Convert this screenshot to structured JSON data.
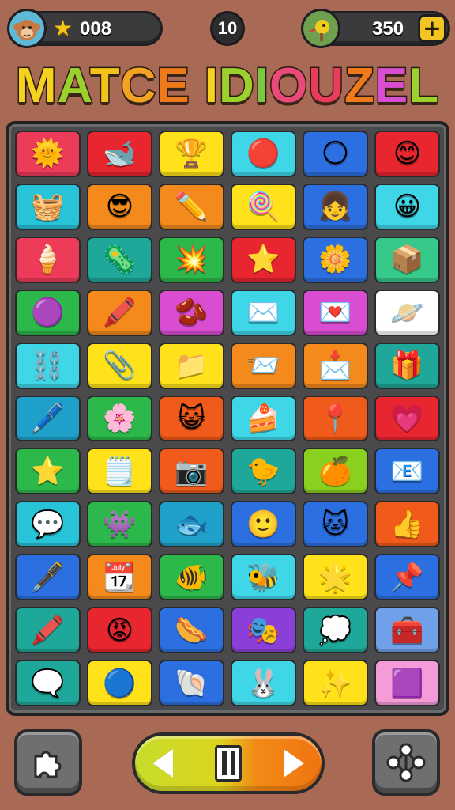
{
  "hud": {
    "player_avatar": "monkey-avatar",
    "stars": "008",
    "level": "10",
    "currency_avatar": "bird-avatar",
    "coins": "350",
    "add_label": "+"
  },
  "title": {
    "letters": [
      {
        "ch": "M",
        "color": "#f4d21e"
      },
      {
        "ch": "A",
        "color": "#9bd12c"
      },
      {
        "ch": "T",
        "color": "#f2c319"
      },
      {
        "ch": "C",
        "color": "#f3a322"
      },
      {
        "ch": "E",
        "color": "#f07a1a"
      },
      {
        "ch": " ",
        "color": "#ffffff"
      },
      {
        "ch": "I",
        "color": "#f4d21e"
      },
      {
        "ch": "D",
        "color": "#9bd12c"
      },
      {
        "ch": "I",
        "color": "#7ac942"
      },
      {
        "ch": "O",
        "color": "#e94a7a"
      },
      {
        "ch": "U",
        "color": "#e93c5b"
      },
      {
        "ch": "Z",
        "color": "#f07a1a"
      },
      {
        "ch": "E",
        "color": "#d94ed1"
      },
      {
        "ch": "L",
        "color": "#9bd12c"
      }
    ]
  },
  "board": {
    "tiles": [
      {
        "bg": "#ef3b5a",
        "icon": "sun-face-icon",
        "glyph": "🌞"
      },
      {
        "bg": "#e8262f",
        "icon": "whale-icon",
        "glyph": "🐋"
      },
      {
        "bg": "#ffe21a",
        "icon": "trophy-icon",
        "glyph": "🏆"
      },
      {
        "bg": "#3fd6e8",
        "icon": "red-ball-face-icon",
        "glyph": "🔴"
      },
      {
        "bg": "#2c6fe0",
        "icon": "moon-icon",
        "glyph": "🌕"
      },
      {
        "bg": "#e8262f",
        "icon": "smiley-sun-icon",
        "glyph": "😊"
      },
      {
        "bg": "#27c3d8",
        "icon": "basket-icon",
        "glyph": "🧺"
      },
      {
        "bg": "#f48a1b",
        "icon": "cool-face-icon",
        "glyph": "😎"
      },
      {
        "bg": "#f48a1b",
        "icon": "pencil-icon",
        "glyph": "✏️"
      },
      {
        "bg": "#ffe21a",
        "icon": "lollipop-icon",
        "glyph": "🍭"
      },
      {
        "bg": "#2c6fe0",
        "icon": "girl-face-icon",
        "glyph": "👧"
      },
      {
        "bg": "#3fd6e8",
        "icon": "smiley-face-icon",
        "glyph": "😀"
      },
      {
        "bg": "#ef3b5a",
        "icon": "popsicle-icon",
        "glyph": "🍦"
      },
      {
        "bg": "#1fa89a",
        "icon": "blob-icon",
        "glyph": "🦠"
      },
      {
        "bg": "#2cb84a",
        "icon": "red-splat-icon",
        "glyph": "💥"
      },
      {
        "bg": "#e8262f",
        "icon": "star-wand-icon",
        "glyph": "⭐"
      },
      {
        "bg": "#2c6fe0",
        "icon": "flower-face-icon",
        "glyph": "🌼"
      },
      {
        "bg": "#36c98a",
        "icon": "box-icon",
        "glyph": "📦"
      },
      {
        "bg": "#2cb84a",
        "icon": "purple-face-icon",
        "glyph": "🟣"
      },
      {
        "bg": "#f48a1b",
        "icon": "crayon-icon",
        "glyph": "🖍️"
      },
      {
        "bg": "#d94ed1",
        "icon": "bean-icon",
        "glyph": "🫘"
      },
      {
        "bg": "#3fd6e8",
        "icon": "envelope-icon",
        "glyph": "✉️"
      },
      {
        "bg": "#d94ed1",
        "icon": "letter-icon",
        "glyph": "💌"
      },
      {
        "bg": "#ffffff",
        "icon": "planet-face-icon",
        "glyph": "🪐"
      },
      {
        "bg": "#3fd6e8",
        "icon": "chain-icon",
        "glyph": "⛓️"
      },
      {
        "bg": "#ffe21a",
        "icon": "clothespin-icon",
        "glyph": "📎"
      },
      {
        "bg": "#ffe21a",
        "icon": "folder-icon",
        "glyph": "📁"
      },
      {
        "bg": "#f48a1b",
        "icon": "mail-icon",
        "glyph": "📨"
      },
      {
        "bg": "#f48a1b",
        "icon": "open-envelope-icon",
        "glyph": "📩"
      },
      {
        "bg": "#1fa89a",
        "icon": "gift-box-icon",
        "glyph": "🎁"
      },
      {
        "bg": "#1fa0c8",
        "icon": "pen-icon",
        "glyph": "🖊️"
      },
      {
        "bg": "#2cb84a",
        "icon": "pink-blob-icon",
        "glyph": "🌸"
      },
      {
        "bg": "#f05a1a",
        "icon": "cat-face-icon",
        "glyph": "😺"
      },
      {
        "bg": "#3fd6e8",
        "icon": "cake-icon",
        "glyph": "🍰"
      },
      {
        "bg": "#f05a1a",
        "icon": "pin-icon",
        "glyph": "📍"
      },
      {
        "bg": "#e8262f",
        "icon": "bubble-face-icon",
        "glyph": "💗"
      },
      {
        "bg": "#2cb84a",
        "icon": "star-face-icon",
        "glyph": "⭐"
      },
      {
        "bg": "#ffe21a",
        "icon": "notepad-icon",
        "glyph": "🗒️"
      },
      {
        "bg": "#f05a1a",
        "icon": "camera-icon",
        "glyph": "📷"
      },
      {
        "bg": "#1fa89a",
        "icon": "chick-icon",
        "glyph": "🐤"
      },
      {
        "bg": "#8ad11f",
        "icon": "orange-face-icon",
        "glyph": "🍊"
      },
      {
        "bg": "#2c6fe0",
        "icon": "envelope-x-icon",
        "glyph": "📧"
      },
      {
        "bg": "#27c3d8",
        "icon": "speech-bubble-icon",
        "glyph": "💬"
      },
      {
        "bg": "#2cb84a",
        "icon": "purple-monster-icon",
        "glyph": "👾"
      },
      {
        "bg": "#1fa0c8",
        "icon": "blue-fish-icon",
        "glyph": "🐟"
      },
      {
        "bg": "#2c6fe0",
        "icon": "yellow-smile-icon",
        "glyph": "🙂"
      },
      {
        "bg": "#2c6fe0",
        "icon": "white-cat-icon",
        "glyph": "🐱"
      },
      {
        "bg": "#f05a1a",
        "icon": "thumbs-up-icon",
        "glyph": "👍"
      },
      {
        "bg": "#2c6fe0",
        "icon": "pen-cap-icon",
        "glyph": "🖋️"
      },
      {
        "bg": "#f48a1b",
        "icon": "calendar-icon",
        "glyph": "📆"
      },
      {
        "bg": "#2cb84a",
        "icon": "red-fish-icon",
        "glyph": "🐠"
      },
      {
        "bg": "#3fd6e8",
        "icon": "bee-face-icon",
        "glyph": "🐝"
      },
      {
        "bg": "#ffe21a",
        "icon": "pink-star-icon",
        "glyph": "🌟"
      },
      {
        "bg": "#2c6fe0",
        "icon": "map-pin-icon",
        "glyph": "📌"
      },
      {
        "bg": "#1fa89a",
        "icon": "marker-icon",
        "glyph": "🖍️"
      },
      {
        "bg": "#e8262f",
        "icon": "red-blob-face-icon",
        "glyph": "😡"
      },
      {
        "bg": "#2c6fe0",
        "icon": "sausage-icon",
        "glyph": "🌭"
      },
      {
        "bg": "#8a3fd9",
        "icon": "mask-icon",
        "glyph": "🎭"
      },
      {
        "bg": "#1fa89a",
        "icon": "yellow-bubble-icon",
        "glyph": "💭"
      },
      {
        "bg": "#6fa0e8",
        "icon": "red-box-icon",
        "glyph": "🧰"
      },
      {
        "bg": "#1fa89a",
        "icon": "orange-bubble-icon",
        "glyph": "🗨️"
      },
      {
        "bg": "#ffe21a",
        "icon": "blue-fuzzball-icon",
        "glyph": "🔵"
      },
      {
        "bg": "#2c6fe0",
        "icon": "shell-icon",
        "glyph": "🐚"
      },
      {
        "bg": "#3fd6e8",
        "icon": "bunny-face-icon",
        "glyph": "🐰"
      },
      {
        "bg": "#ffe21a",
        "icon": "stars-icon",
        "glyph": "✨"
      },
      {
        "bg": "#f59bd8",
        "icon": "fuzzball-icon",
        "glyph": "🟪"
      }
    ]
  },
  "controls": {
    "left_button_icon": "puzzle-piece-icon",
    "left_button_glyph": "🧩",
    "right_button_icon": "network-icon",
    "right_button_glyph": "⚛"
  }
}
